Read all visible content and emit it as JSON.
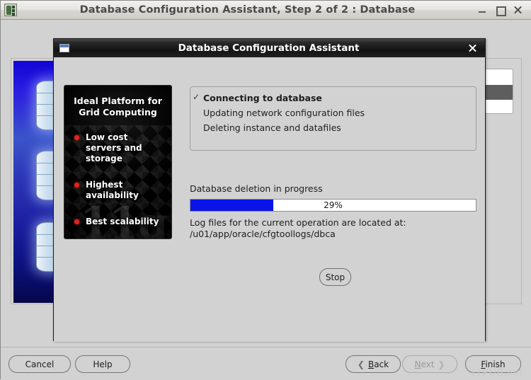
{
  "main_window": {
    "title": "Database Configuration Assistant, Step 2 of 2 : Database",
    "app_icon": "oracle-dbca-icon",
    "controls": {
      "minimize": "minimize-icon",
      "maximize": "maximize-icon",
      "close": "close-icon"
    },
    "watermark": "ITPUB.net"
  },
  "footer": {
    "cancel": "Cancel",
    "help": "Help",
    "back": "Back",
    "back_mnemonic": "B",
    "next": "Next",
    "next_mnemonic": "N",
    "next_disabled": true,
    "finish": "Finish",
    "finish_mnemonic": "F",
    "back_chevron": "❮",
    "next_chevron": "❯"
  },
  "dialog": {
    "title": "Database Configuration Assistant",
    "icon": "window-icon",
    "close": "close-icon",
    "splash": {
      "heading_line1": "Ideal Platform for",
      "heading_line2": "Grid Computing",
      "version_mark": "11g",
      "bullets": [
        "Low cost servers and storage",
        "Highest availability",
        "Best scalability"
      ]
    },
    "status": {
      "check_glyph": "✓",
      "items": [
        "Connecting to database",
        "Updating network configuration files",
        "Deleting instance and datafiles"
      ]
    },
    "progress": {
      "label": "Database deletion in progress",
      "percent_text": "29%",
      "percent_value": 29,
      "fill_color": "#0a13e8"
    },
    "log": {
      "line1": "Log files for the current operation are located at:",
      "line2": "/u01/app/oracle/cfgtoollogs/dbca"
    },
    "stop_button": "Stop"
  }
}
